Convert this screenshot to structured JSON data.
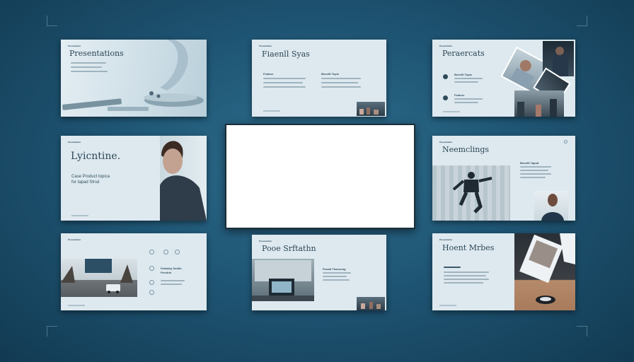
{
  "slides": {
    "s1": {
      "brand": "Presentation",
      "title": "Presentations"
    },
    "s2": {
      "brand": "Presentation",
      "title": "Fiaenll Syas",
      "sub1": "Feature",
      "sub2": "Benefit Topic"
    },
    "s3": {
      "brand": "Presentation",
      "title": "Peraercats",
      "sub1": "Benefit Topic",
      "sub2": "Feature"
    },
    "s4": {
      "brand": "Presentation",
      "title": "Lyicntine.",
      "subtitle_line1": "Case Product topica",
      "subtitle_line2": "for tapad Strsd"
    },
    "s5": {
      "brand": "Presentation",
      "title": "Neemclings",
      "sub1": "Benefit Tapolt"
    },
    "s6": {
      "brand": "Presentation",
      "sub1": "Fanlalny Sodits",
      "sub2": "Presfrts"
    },
    "s7": {
      "brand": "Presentation",
      "title": "Pooe Srftathn",
      "sub1": "Poxatt Tissornng"
    },
    "s8": {
      "brand": "Presentation",
      "title": "Hoent Mrbes"
    }
  },
  "colors": {
    "background": "#1f5675",
    "slide": "#dde9ef",
    "accent": "#2c4656"
  }
}
